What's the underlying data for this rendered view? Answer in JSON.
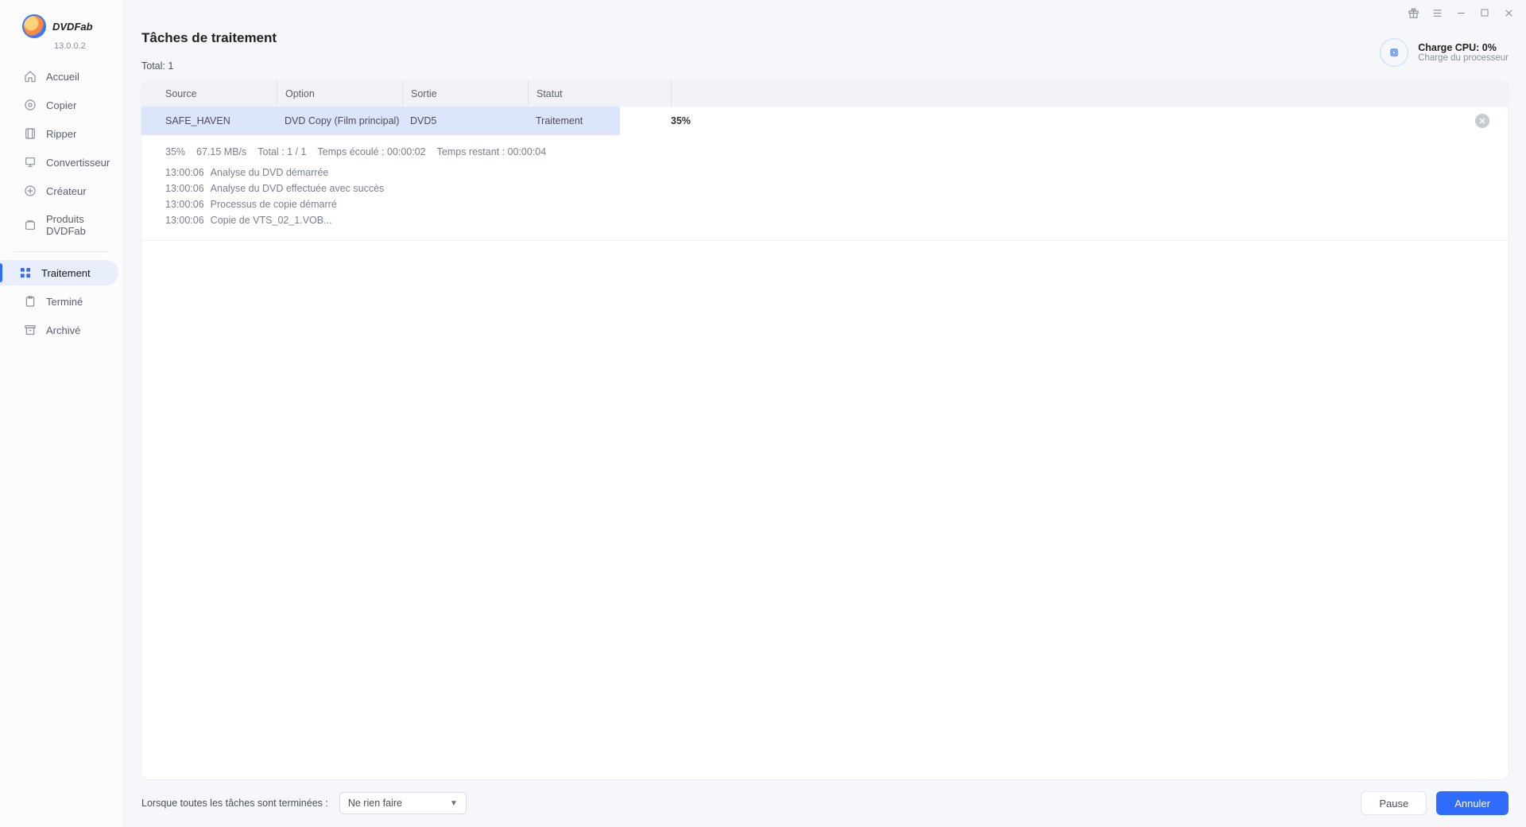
{
  "app": {
    "name": "DVDFab",
    "version": "13.0.0.2"
  },
  "sidebar": {
    "items": [
      {
        "icon": "home-icon",
        "label": "Accueil"
      },
      {
        "icon": "copy-icon",
        "label": "Copier"
      },
      {
        "icon": "ripper-icon",
        "label": "Ripper"
      },
      {
        "icon": "converter-icon",
        "label": "Convertisseur"
      },
      {
        "icon": "creator-icon",
        "label": "Créateur"
      },
      {
        "icon": "products-icon",
        "label": "Produits DVDFab"
      }
    ],
    "secondary": [
      {
        "icon": "processing-icon",
        "label": "Traitement",
        "active": true
      },
      {
        "icon": "finished-icon",
        "label": "Terminé"
      },
      {
        "icon": "archived-icon",
        "label": "Archivé"
      }
    ]
  },
  "header": {
    "page_title": "Tâches de traitement",
    "total_label": "Total:",
    "total_value": "1",
    "cpu": {
      "title": "Charge CPU: 0%",
      "sub": "Charge du processeur"
    }
  },
  "table": {
    "columns": {
      "source": "Source",
      "option": "Option",
      "sortie": "Sortie",
      "statut": "Statut"
    },
    "row": {
      "source": "SAFE_HAVEN",
      "option": "DVD Copy (Film principal)",
      "sortie": "DVD5",
      "statut": "Traitement",
      "percent": "35%"
    }
  },
  "details": {
    "stats": {
      "percent": "35%",
      "speed": "67.15 MB/s",
      "total": "Total : 1 / 1",
      "elapsed": "Temps écoulé : 00:00:02",
      "remaining": "Temps restant : 00:00:04"
    },
    "log": [
      {
        "time": "13:00:06",
        "msg": "Analyse du DVD démarrée"
      },
      {
        "time": "13:00:06",
        "msg": "Analyse du DVD effectuée avec succès"
      },
      {
        "time": "13:00:06",
        "msg": "Processus de copie démarré"
      },
      {
        "time": "13:00:06",
        "msg": "Copie de VTS_02_1.VOB..."
      }
    ]
  },
  "footer": {
    "when_done_label": "Lorsque toutes les tâches sont terminées :",
    "when_done_value": "Ne rien faire",
    "pause": "Pause",
    "cancel": "Annuler"
  }
}
